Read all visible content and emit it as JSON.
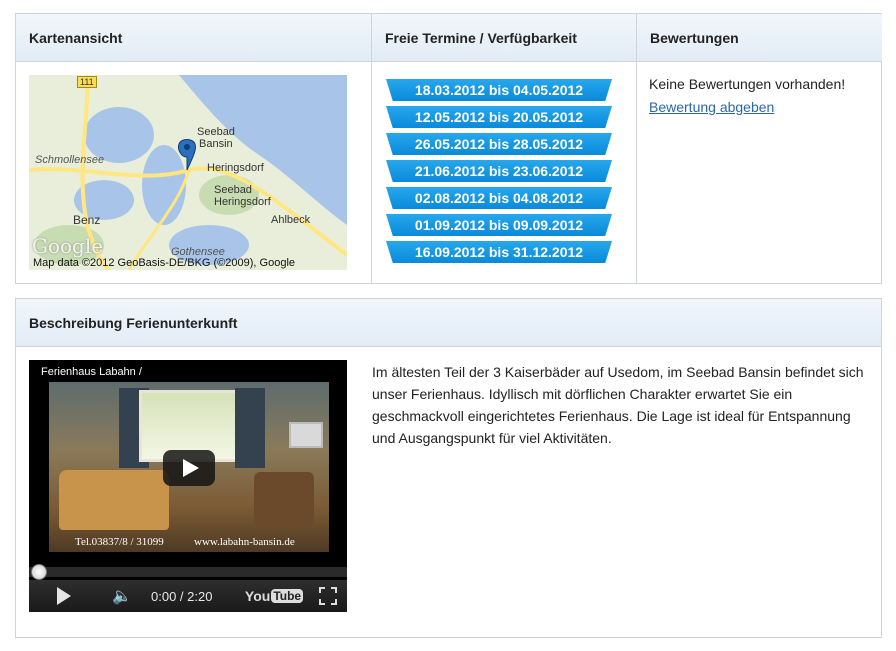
{
  "top_section": {
    "map_header": "Kartenansicht",
    "dates_header": "Freie Termine / Verfügbarkeit",
    "ratings_header": "Bewertungen"
  },
  "map": {
    "road_badge": "111",
    "labels": [
      "Seebad",
      "Bansin",
      "Heringsdorf",
      "Seebad",
      "Heringsdorf",
      "Schmollensee",
      "Benz",
      "Ahlbeck",
      "Gothensee"
    ],
    "google_logo": "Google",
    "copyright": "Map data ©2012 GeoBasis-DE/BKG (©2009), Google",
    "marker_icon": "map-pin-icon",
    "colors": {
      "water": "#a8c4e8",
      "land": "#e8eed9",
      "forest": "#c7dcb0",
      "road": "#ffe680"
    }
  },
  "available_dates": [
    "18.03.2012 bis 04.05.2012",
    "12.05.2012 bis 20.05.2012",
    "26.05.2012 bis 28.05.2012",
    "21.06.2012 bis 23.06.2012",
    "02.08.2012 bis 04.08.2012",
    "01.09.2012 bis 09.09.2012",
    "16.09.2012 bis 31.12.2012"
  ],
  "ratings": {
    "empty_text": "Keine Bewertungen vorhanden!",
    "submit_link": "Bewertung abgeben"
  },
  "description_section": {
    "header": "Beschreibung Ferienunterkunft",
    "text": "Im ältesten Teil der 3 Kaiserbäder auf Usedom, im Seebad Bansin befindet sich unser Ferienhaus. Idyllisch mit dörflichen Charakter erwartet Sie ein geschmackvoll eingerichtetes Ferienhaus. Die Lage ist ideal für Entspannung und Ausgangspunkt für viel Aktivitäten."
  },
  "video": {
    "title": "Ferienhaus Labahn / ",
    "caption_left": "Tel.03837/8 / 31099",
    "caption_right": "www.labahn-bansin.de",
    "time": "0:00 / 2:20",
    "progress": 0,
    "youtube_label": "You",
    "youtube_tube": "Tube",
    "icons": [
      "play-icon",
      "volume-icon",
      "fullscreen-icon"
    ]
  },
  "colors": {
    "accent_blue": "#1a96e0",
    "link": "#2a67a8",
    "header_bg": "#e6eef7",
    "border": "#cfd4da"
  }
}
